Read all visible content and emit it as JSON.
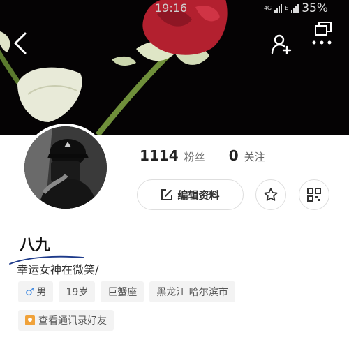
{
  "status_bar": {
    "time": "19:16",
    "network_top": "4G",
    "network_bottom": "E",
    "battery": "35%"
  },
  "profile": {
    "name": "八九",
    "bio": "幸运女神在微笑/",
    "fans_count": "1114",
    "fans_label": "粉丝",
    "following_count": "0",
    "following_label": "关注",
    "edit_label": "编辑资料"
  },
  "tags": {
    "gender_symbol": "♂",
    "gender": "男",
    "age": "19岁",
    "zodiac": "巨蟹座",
    "location": "黑龙江 哈尔滨市"
  },
  "contacts": {
    "label": "查看通讯录好友"
  },
  "icons": {
    "back": "back-arrow-icon",
    "add_friend": "add-person-icon",
    "window": "window-icon",
    "more": "more-dots-icon",
    "edit": "edit-icon",
    "star": "star-icon",
    "qr": "qr-code-icon",
    "contacts": "contacts-icon"
  },
  "colors": {
    "accent_blue": "#3a86e0",
    "rose_red": "#b3202f",
    "contacts_orange": "#f0a23a"
  }
}
